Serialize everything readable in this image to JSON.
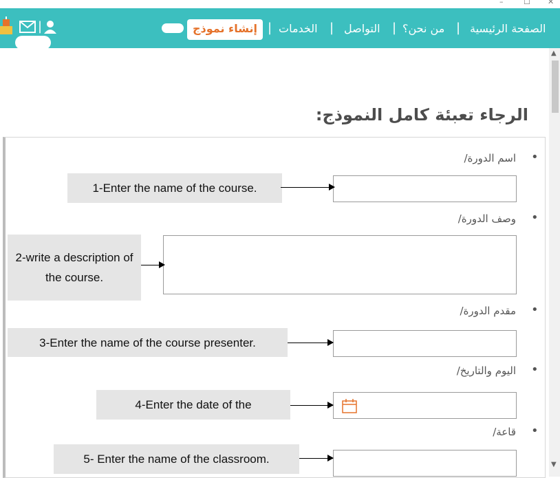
{
  "window": {
    "minimize": "–",
    "maximize": "☐",
    "close": "✕"
  },
  "nav": {
    "home": "الصفحة الرئيسية",
    "about": "من نحن؟",
    "contact": "التواصل",
    "services": "الخدمات",
    "create_form": "إنشاء نموذج",
    "separator": "|",
    "icons": [
      "user-icon",
      "mail-icon",
      "logo-icon"
    ]
  },
  "form": {
    "heading": "الرجاء تعبئة كامل النموذج:",
    "fields": {
      "course_name": "اسم الدورة/",
      "course_description": "وصف الدورة/",
      "course_presenter": "مقدم الدورة/",
      "day_date": "اليوم والتاريخ/",
      "classroom": "قاعة/"
    }
  },
  "callouts": {
    "c1": "1-Enter the name of the course.",
    "c2": "2-write a description of the course.",
    "c3": "3-Enter the name of the course presenter.",
    "c4": "4-Enter the date of the",
    "c5": "5- Enter the name of the classroom."
  },
  "colors": {
    "navbar": "#3cbfbf",
    "accent": "#e5722b"
  }
}
